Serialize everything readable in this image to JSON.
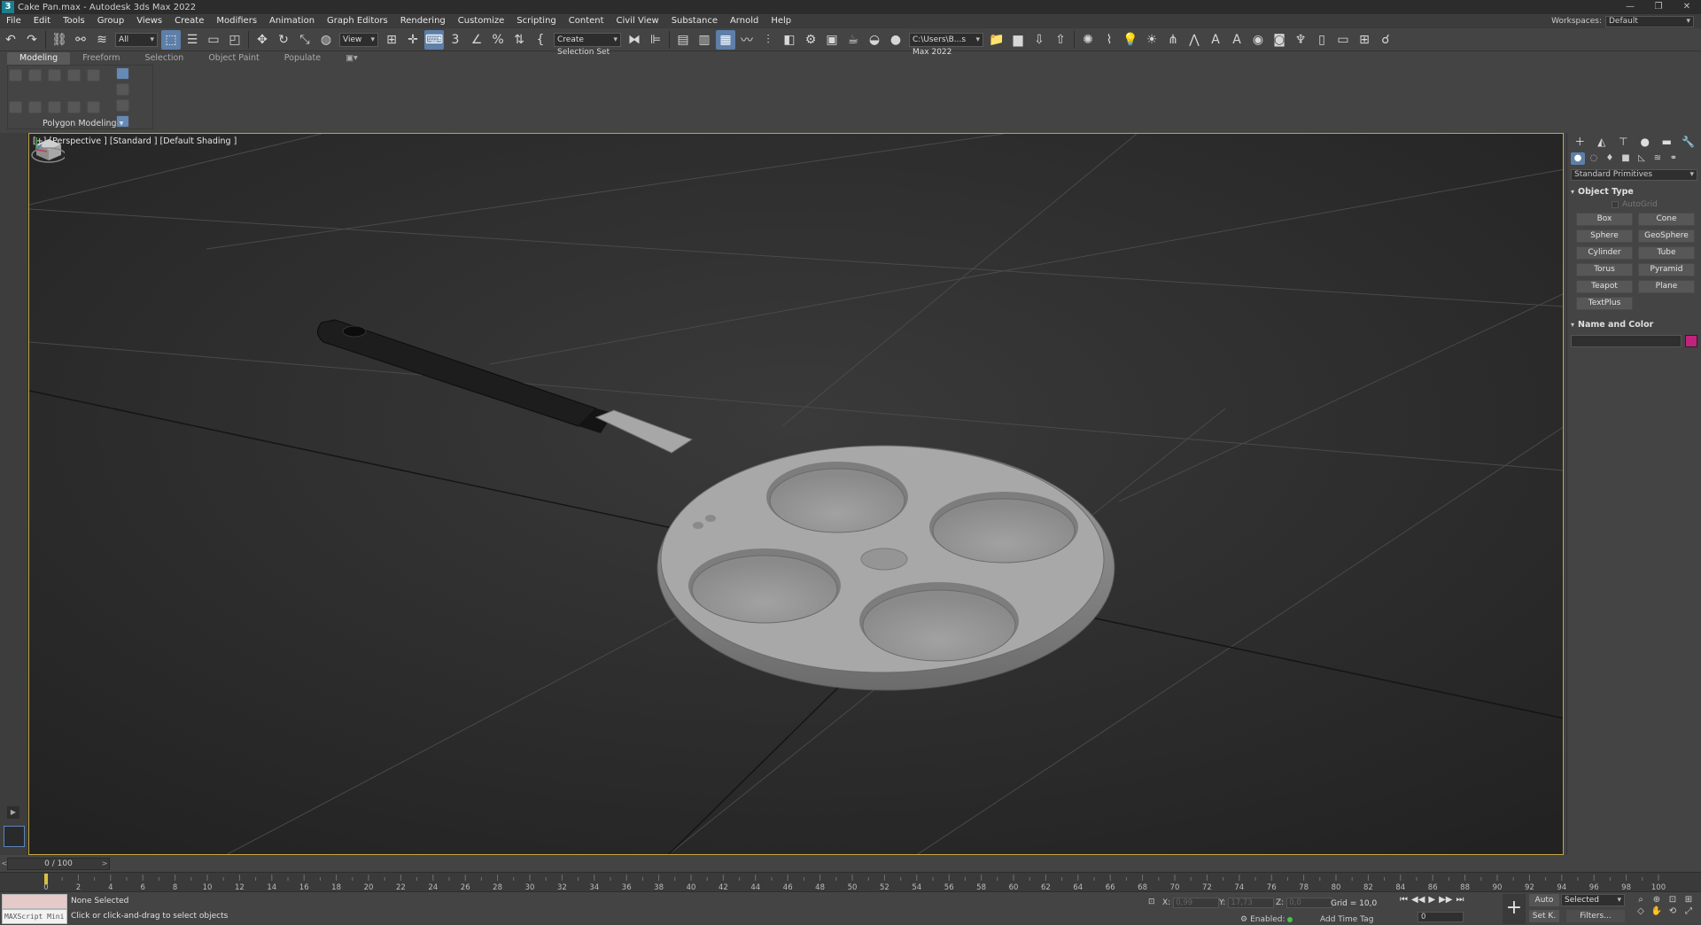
{
  "window": {
    "title": "Cake Pan.max - Autodesk 3ds Max 2022",
    "controls": [
      "—",
      "❐",
      "✕"
    ]
  },
  "menu": [
    "File",
    "Edit",
    "Tools",
    "Group",
    "Views",
    "Create",
    "Modifiers",
    "Animation",
    "Graph Editors",
    "Rendering",
    "Customize",
    "Scripting",
    "Content",
    "Civil View",
    "Substance",
    "Arnold",
    "Help"
  ],
  "workspace": {
    "label": "Workspaces:",
    "value": "Default"
  },
  "toolbar": {
    "selection_filter": "All",
    "ref_coord": "View",
    "named_selection": "Create Selection Set",
    "project_path": "C:\\Users\\B...s Max 2022"
  },
  "ribbon": {
    "tabs": [
      "Modeling",
      "Freeform",
      "Selection",
      "Object Paint",
      "Populate"
    ],
    "panel_label": "Polygon Modeling ▾"
  },
  "viewport": {
    "label": "[+] [Perspective ] [Standard ] [Default Shading ]"
  },
  "command_panel": {
    "category": "Standard Primitives",
    "object_type_title": "Object Type",
    "autogrid_label": "AutoGrid",
    "primitives": [
      "Box",
      "Cone",
      "Sphere",
      "GeoSphere",
      "Cylinder",
      "Tube",
      "Torus",
      "Pyramid",
      "Teapot",
      "Plane",
      "TextPlus"
    ],
    "name_color_title": "Name and Color",
    "object_color": "#c0237a"
  },
  "timeline": {
    "slider_label": "0 / 100",
    "ticks": [
      0,
      2,
      4,
      6,
      8,
      10,
      12,
      14,
      16,
      18,
      20,
      22,
      24,
      26,
      28,
      30,
      32,
      34,
      36,
      38,
      40,
      42,
      44,
      46,
      48,
      50,
      52,
      54,
      56,
      58,
      60,
      62,
      64,
      66,
      68,
      70,
      72,
      74,
      76,
      78,
      80,
      82,
      84,
      86,
      88,
      90,
      92,
      94,
      96,
      98,
      100
    ]
  },
  "status": {
    "maxscript_label": "MAXScript Mini",
    "selection_text": "None Selected",
    "prompt_text": "Click or click-and-drag to select objects",
    "x_label": "X:",
    "x_value": "0,99",
    "y_label": "Y:",
    "y_value": "17,73",
    "z_label": "Z:",
    "z_value": "0,0",
    "grid_text": "Grid = 10,0",
    "enabled_label": "Enabled:",
    "add_time_tag": "Add Time Tag",
    "auto_label": "Auto",
    "setk_label": "Set K.",
    "selected_option": "Selected",
    "filters_label": "Filters...",
    "frame_value": "0"
  }
}
